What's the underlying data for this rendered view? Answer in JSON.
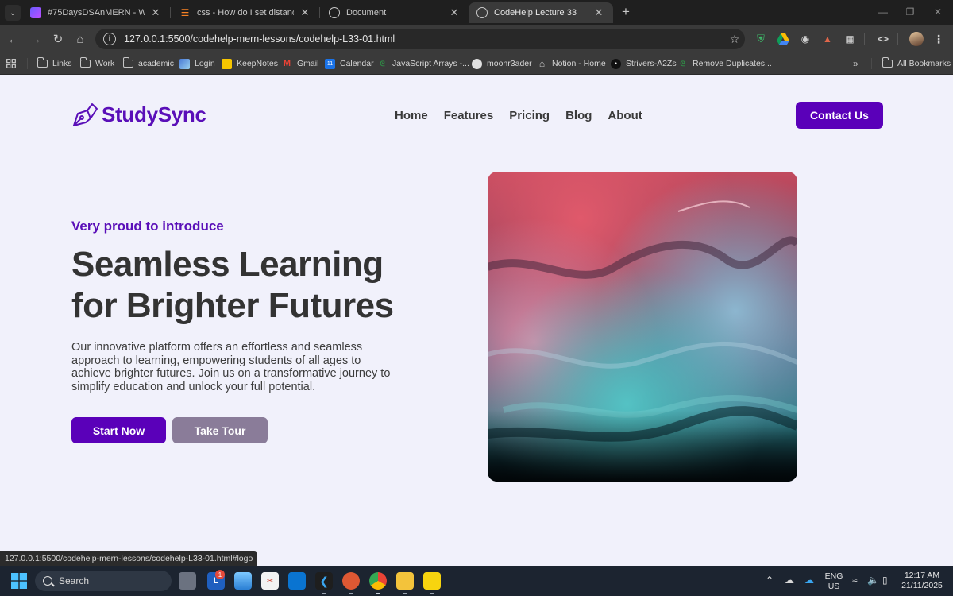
{
  "browser": {
    "tabs": [
      {
        "title": "#75DaysDSAnMERN - Whitebo",
        "active": false
      },
      {
        "title": "css - How do I set distance betw",
        "active": false
      },
      {
        "title": "Document",
        "active": false
      },
      {
        "title": "CodeHelp Lecture 33",
        "active": true
      }
    ],
    "url": "127.0.0.1:5500/codehelp-mern-lessons/codehelp-L33-01.html",
    "bookmarks": [
      {
        "label": "Links",
        "icon": "folder-icon"
      },
      {
        "label": "Work",
        "icon": "folder-icon"
      },
      {
        "label": "academic",
        "icon": "folder-icon"
      },
      {
        "label": "Login",
        "icon": "login-icon"
      },
      {
        "label": "KeepNotes",
        "icon": "keep-icon"
      },
      {
        "label": "Gmail",
        "icon": "gmail-icon"
      },
      {
        "label": "Calendar",
        "icon": "calendar-icon"
      },
      {
        "label": "JavaScript Arrays -...",
        "icon": "gfg-icon"
      },
      {
        "label": "moonr3ader",
        "icon": "github-icon"
      },
      {
        "label": "Notion - Home",
        "icon": "home-icon"
      },
      {
        "label": "Strivers-A2Zs",
        "icon": "tuf-icon"
      },
      {
        "label": "Remove Duplicates...",
        "icon": "gfg-icon"
      }
    ],
    "all_bookmarks": "All Bookmarks",
    "calendar_day": "11",
    "status_url": "127.0.0.1:5500/codehelp-mern-lessons/codehelp-L33-01.html#logo"
  },
  "page": {
    "brand": "StudySync",
    "nav": [
      "Home",
      "Features",
      "Pricing",
      "Blog",
      "About"
    ],
    "contact_label": "Contact Us",
    "eyebrow": "Very proud to introduce",
    "headline_line1": "Seamless Learning",
    "headline_line2": "for Brighter Futures",
    "description": "Our innovative platform offers an effortless and seamless approach to learning, empowering students of all ages to achieve brighter futures. Join us on a transformative journey to simplify education and unlock your full potential.",
    "primary_cta": "Start Now",
    "secondary_cta": "Take Tour",
    "colors": {
      "brand": "#5a00b9",
      "secondary": "#8a7c99",
      "background": "#f1f1fb",
      "text": "#333333"
    }
  },
  "taskbar": {
    "search_label": "Search",
    "notification_badge": "1",
    "lang_line1": "ENG",
    "lang_line2": "US",
    "time": "12:17 AM",
    "date": "21/11/2025"
  }
}
